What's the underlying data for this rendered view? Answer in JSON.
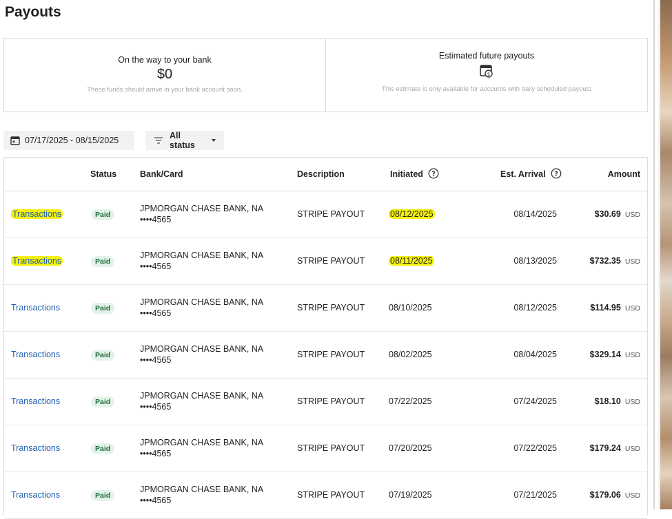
{
  "page": {
    "title": "Payouts"
  },
  "summary": {
    "on_the_way": {
      "title": "On the way to your bank",
      "amount": "$0",
      "note": "These funds should arrive in your bank account soon."
    },
    "estimated": {
      "title": "Estimated future payouts",
      "note": "This estimate is only available for accounts with daily scheduled payouts"
    }
  },
  "filters": {
    "date_range": "07/17/2025 - 08/15/2025",
    "status": "All status"
  },
  "table": {
    "headers": {
      "status": "Status",
      "bank": "Bank/Card",
      "description": "Description",
      "initiated": "Initiated",
      "arrival": "Est. Arrival",
      "amount": "Amount"
    },
    "rows": [
      {
        "link": "Transactions",
        "status": "Paid",
        "bank": "JPMORGAN CHASE BANK, NA",
        "card": "••••4565",
        "description": "STRIPE PAYOUT",
        "initiated": "08/12/2025",
        "arrival": "08/14/2025",
        "amount": "$30.69",
        "currency": "USD"
      },
      {
        "link": "Transactions",
        "status": "Paid",
        "bank": "JPMORGAN CHASE BANK, NA",
        "card": "••••4565",
        "description": "STRIPE PAYOUT",
        "initiated": "08/11/2025",
        "arrival": "08/13/2025",
        "amount": "$732.35",
        "currency": "USD"
      },
      {
        "link": "Transactions",
        "status": "Paid",
        "bank": "JPMORGAN CHASE BANK, NA",
        "card": "••••4565",
        "description": "STRIPE PAYOUT",
        "initiated": "08/10/2025",
        "arrival": "08/12/2025",
        "amount": "$114.95",
        "currency": "USD"
      },
      {
        "link": "Transactions",
        "status": "Paid",
        "bank": "JPMORGAN CHASE BANK, NA",
        "card": "••••4565",
        "description": "STRIPE PAYOUT",
        "initiated": "08/02/2025",
        "arrival": "08/04/2025",
        "amount": "$329.14",
        "currency": "USD"
      },
      {
        "link": "Transactions",
        "status": "Paid",
        "bank": "JPMORGAN CHASE BANK, NA",
        "card": "••••4565",
        "description": "STRIPE PAYOUT",
        "initiated": "07/22/2025",
        "arrival": "07/24/2025",
        "amount": "$18.10",
        "currency": "USD"
      },
      {
        "link": "Transactions",
        "status": "Paid",
        "bank": "JPMORGAN CHASE BANK, NA",
        "card": "••••4565",
        "description": "STRIPE PAYOUT",
        "initiated": "07/20/2025",
        "arrival": "07/22/2025",
        "amount": "$179.24",
        "currency": "USD"
      },
      {
        "link": "Transactions",
        "status": "Paid",
        "bank": "JPMORGAN CHASE BANK, NA",
        "card": "••••4565",
        "description": "STRIPE PAYOUT",
        "initiated": "07/19/2025",
        "arrival": "07/21/2025",
        "amount": "$179.06",
        "currency": "USD"
      }
    ]
  },
  "highlights": {
    "color": "#f4f20c",
    "rows_highlighted": [
      0,
      1
    ]
  },
  "colors": {
    "link": "#1f5fb0",
    "paid_badge_bg": "#e3f3e9",
    "paid_badge_text": "#1d6b3a"
  },
  "icons": {
    "calendar": "calendar-icon",
    "filter": "filter-icon",
    "dropdown": "caret-down-icon",
    "help": "help-circle-icon",
    "payout_calendar": "calendar-dollar-icon"
  }
}
